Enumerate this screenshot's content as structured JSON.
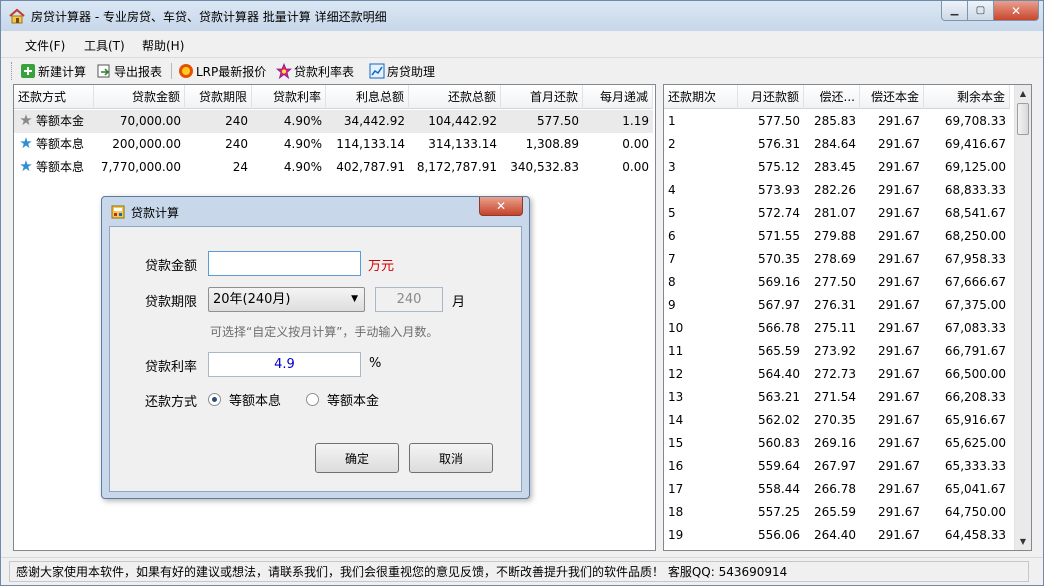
{
  "window": {
    "title": "房贷计算器 - 专业房贷、车贷、贷款计算器 批量计算 详细还款明细",
    "controls": [
      "minimize",
      "maximize",
      "close"
    ]
  },
  "menu": [
    "文件(F)",
    "工具(T)",
    "帮助(H)"
  ],
  "toolbar": {
    "buttons": [
      {
        "label": "新建计算",
        "icon": "plus-icon"
      },
      {
        "label": "导出报表",
        "icon": "export-icon"
      },
      {
        "label": "LRP最新报价",
        "icon": "badge-icon"
      },
      {
        "label": "贷款利率表",
        "icon": "star-colorful-icon"
      },
      {
        "label": "房贷助理",
        "icon": "chart-icon"
      }
    ]
  },
  "loan_table": {
    "columns": [
      "还款方式",
      "贷款金额",
      "贷款期限",
      "贷款利率",
      "利息总额",
      "还款总额",
      "首月还款",
      "每月递减"
    ],
    "rows": [
      {
        "cells": [
          "等额本金",
          "70,000.00",
          "240",
          "4.90%",
          "34,442.92",
          "104,442.92",
          "577.50",
          "1.19"
        ],
        "icon": "star-gray-icon",
        "star_color": "#8a8a8a",
        "selected": true
      },
      {
        "cells": [
          "等额本息",
          "200,000.00",
          "240",
          "4.90%",
          "114,133.14",
          "314,133.14",
          "1,308.89",
          "0.00"
        ],
        "icon": "star-blue-icon",
        "star_color": "#2f8fd0",
        "selected": false
      },
      {
        "cells": [
          "等额本息",
          "7,770,000.00",
          "24",
          "4.90%",
          "402,787.91",
          "8,172,787.91",
          "340,532.83",
          "0.00"
        ],
        "icon": "star-blue-icon",
        "star_color": "#2f8fd0",
        "selected": false
      }
    ]
  },
  "schedule_table": {
    "columns": [
      "还款期次",
      "月还款额",
      "偿还...",
      "偿还本金",
      "剩余本金"
    ],
    "rows": [
      [
        "1",
        "577.50",
        "285.83",
        "291.67",
        "69,708.33"
      ],
      [
        "2",
        "576.31",
        "284.64",
        "291.67",
        "69,416.67"
      ],
      [
        "3",
        "575.12",
        "283.45",
        "291.67",
        "69,125.00"
      ],
      [
        "4",
        "573.93",
        "282.26",
        "291.67",
        "68,833.33"
      ],
      [
        "5",
        "572.74",
        "281.07",
        "291.67",
        "68,541.67"
      ],
      [
        "6",
        "571.55",
        "279.88",
        "291.67",
        "68,250.00"
      ],
      [
        "7",
        "570.35",
        "278.69",
        "291.67",
        "67,958.33"
      ],
      [
        "8",
        "569.16",
        "277.50",
        "291.67",
        "67,666.67"
      ],
      [
        "9",
        "567.97",
        "276.31",
        "291.67",
        "67,375.00"
      ],
      [
        "10",
        "566.78",
        "275.11",
        "291.67",
        "67,083.33"
      ],
      [
        "11",
        "565.59",
        "273.92",
        "291.67",
        "66,791.67"
      ],
      [
        "12",
        "564.40",
        "272.73",
        "291.67",
        "66,500.00"
      ],
      [
        "13",
        "563.21",
        "271.54",
        "291.67",
        "66,208.33"
      ],
      [
        "14",
        "562.02",
        "270.35",
        "291.67",
        "65,916.67"
      ],
      [
        "15",
        "560.83",
        "269.16",
        "291.67",
        "65,625.00"
      ],
      [
        "16",
        "559.64",
        "267.97",
        "291.67",
        "65,333.33"
      ],
      [
        "17",
        "558.44",
        "266.78",
        "291.67",
        "65,041.67"
      ],
      [
        "18",
        "557.25",
        "265.59",
        "291.67",
        "64,750.00"
      ],
      [
        "19",
        "556.06",
        "264.40",
        "291.67",
        "64,458.33"
      ]
    ]
  },
  "dialog": {
    "title": "贷款计算",
    "amount_label": "贷款金额",
    "amount_value": "",
    "amount_unit": "万元",
    "term_label": "贷款期限",
    "term_selected": "20年(240月)",
    "term_months": "240",
    "term_unit": "月",
    "hint": "可选择“自定义按月计算”，手动输入月数。",
    "rate_label": "贷款利率",
    "rate_value": "4.9",
    "rate_unit": "%",
    "method_label": "还款方式",
    "method_options": [
      {
        "label": "等额本息",
        "checked": true
      },
      {
        "label": "等额本金",
        "checked": false
      }
    ],
    "ok_label": "确定",
    "cancel_label": "取消"
  },
  "status": {
    "text": "感谢大家使用本软件，如果有好的建议或想法，请联系我们，我们会很重视您的意见反馈，不断改善提升我们的软件品质！ 客服QQ: 543690914"
  },
  "colors": {
    "unit_red": "#d40000",
    "rate_blue": "#0000c8",
    "star_gray": "#8a8a8a",
    "star_blue": "#2f8fd0"
  }
}
